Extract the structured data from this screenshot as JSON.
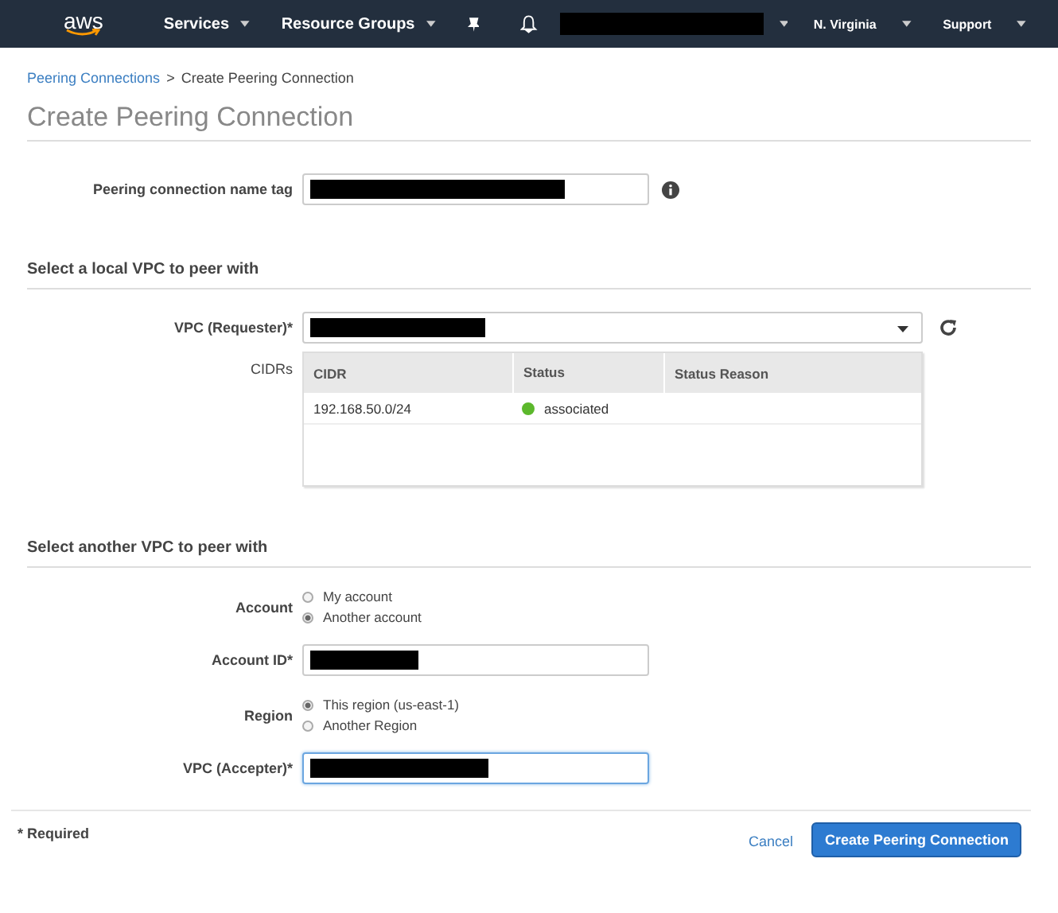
{
  "navbar": {
    "logo": "aws",
    "items": [
      {
        "label": "Services",
        "dropdown": true
      },
      {
        "label": "Resource Groups",
        "dropdown": true
      }
    ],
    "account": {
      "redacted": true
    },
    "region": "N. Virginia",
    "support": "Support"
  },
  "breadcrumb": {
    "link": "Peering Connections",
    "separator": ">",
    "current": "Create Peering Connection"
  },
  "title": "Create Peering Connection",
  "name_tag": {
    "label": "Peering connection name tag",
    "redacted": true
  },
  "local_section": {
    "heading": "Select a local VPC to peer with",
    "vpc": {
      "label": "VPC (Requester)*",
      "redacted": true
    },
    "cidrs": {
      "label": "CIDRs",
      "columns": [
        "CIDR",
        "Status",
        "Status Reason"
      ],
      "rows": [
        {
          "cidr": "192.168.50.0/24",
          "status": "associated",
          "color": "#5cb82c"
        }
      ]
    }
  },
  "peer_section": {
    "heading": "Select another VPC to peer with",
    "account": {
      "label": "Account",
      "options": [
        {
          "label": "My account",
          "selected": false
        },
        {
          "label": "Another account",
          "selected": true
        }
      ]
    },
    "account_id": {
      "label": "Account ID*",
      "redacted": true
    },
    "region": {
      "label": "Region",
      "options": [
        {
          "label": "This region (us-east-1)",
          "selected": true
        },
        {
          "label": "Another Region",
          "selected": false
        }
      ]
    },
    "vpc": {
      "label": "VPC (Accepter)*",
      "redacted": true,
      "focused": true
    }
  },
  "footer": {
    "required_note": "* Required",
    "cancel": "Cancel",
    "submit": "Create Peering Connection"
  }
}
